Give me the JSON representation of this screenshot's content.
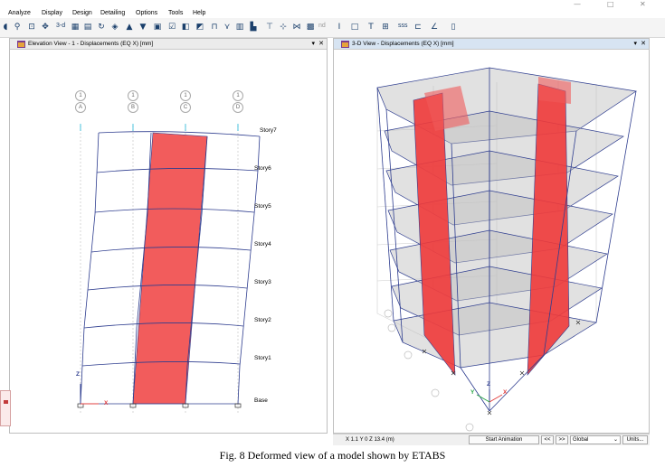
{
  "menu": {
    "items": [
      "Analyze",
      "Display",
      "Design",
      "Detailing",
      "Options",
      "Tools",
      "Help"
    ],
    "window_controls": [
      "—",
      "□",
      "✕"
    ]
  },
  "toolbar": {
    "three_d_label": "3-d",
    "nd_label": "nd",
    "sss_label": "sss"
  },
  "left_pane": {
    "title": "Elevation View - 1  - Displacements (EQ X)  [mm]",
    "pin": "▾",
    "close": "✕",
    "grid_top": [
      "1",
      "1",
      "1",
      "1"
    ],
    "grid_labels": [
      "A",
      "B",
      "C",
      "D"
    ],
    "stories": [
      "Story7",
      "Story6",
      "Story5",
      "Story4",
      "Story3",
      "Story2",
      "Story1",
      "Base"
    ],
    "axis_z": "Z",
    "axis_x": "X"
  },
  "right_pane": {
    "title": "3-D View  - Displacements (EQ X)  [mm]",
    "pin": "▾",
    "close": "✕",
    "axis_z": "Z",
    "axis_y": "Y",
    "axis_x": "X"
  },
  "status": {
    "coords": "X 1.1  Y 0  Z 13.4 (m)",
    "start_animation": "Start Animation",
    "prev": "<<",
    "next": ">>",
    "coord_system": "Global",
    "units": "Units..."
  },
  "caption": "Fig. 8  Deformed view of a model shown by ETABS",
  "colors": {
    "frame_blue": "#2e3d8f",
    "shear_wall_red": "#f05555",
    "slab_gray": "#d6d6d6"
  }
}
